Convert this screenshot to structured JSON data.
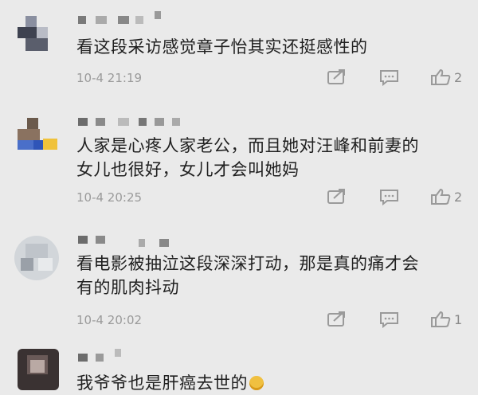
{
  "comments": [
    {
      "name": "",
      "text": "看这段采访感觉章子怡其实还挺感性的",
      "time": "10-4 21:19",
      "likes": "2"
    },
    {
      "name": "",
      "text": "人家是心疼人家老公，而且她对汪峰和前妻的女儿也很好，女儿才会叫她妈",
      "time": "10-4 20:25",
      "likes": "2"
    },
    {
      "name": "",
      "text": "看电影被抽泣这段深深打动，那是真的痛才会有的肌肉抖动",
      "time": "10-4 20:02",
      "likes": "1"
    },
    {
      "name": "",
      "text": "我爷爷也是肝癌去世的",
      "emoji": "crying-emoji"
    }
  ],
  "colors": {
    "background": "#eaeaea",
    "icon": "#9a9a9a",
    "time": "#9a9a9a"
  },
  "icons": [
    "repost-icon",
    "comment-icon",
    "like-icon"
  ]
}
